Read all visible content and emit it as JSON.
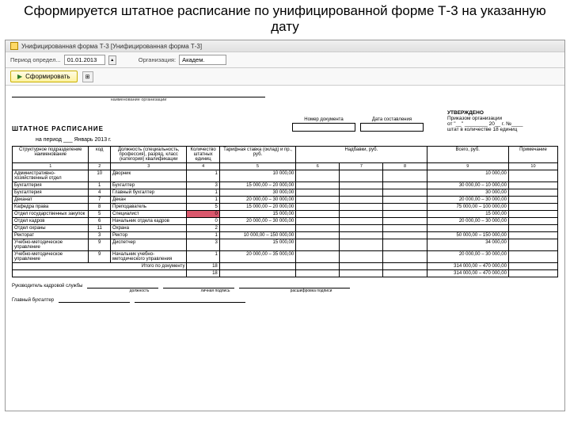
{
  "slide_title": "Сформируется штатное расписание по унифицированной форме Т-3 на указанную дату",
  "window": {
    "title": "Унифицированная форма Т-3 [Унифицированная форма Т-3]"
  },
  "toolbar": {
    "period_label": "Период определ...",
    "date": "01.01.2013",
    "org_label": "Организация:",
    "org_value": "Академ.",
    "generate": "Сформировать"
  },
  "doc": {
    "code_label": "",
    "org_sublabel": "наименование организации",
    "docnum_label": "Номер документа",
    "date_label": "Дата составления",
    "title": "ШТАТНОЕ РАСПИСАНИЕ",
    "approve_title": "УТВЕРЖДЕНО",
    "approve_line1": "Приказом организации",
    "approve_line2": "от \"__\" ________ 20__ г. №____",
    "approve_line3": "штат в количестве 18 единиц",
    "period": "на период ___ Январь 2013 г.",
    "cols": {
      "c1": "Структурное подразделение\nнаименование",
      "c2": "код",
      "c3": "Должность (специальность, профессия), разряд, класс (категория) квалификации",
      "c4": "Количество штатных единиц",
      "c5": "Тарифная ставка (оклад) и пр., руб.",
      "c6_8": "Надбавки, руб.",
      "c9": "Всего, руб.",
      "c10": "Примечание"
    },
    "rows": [
      {
        "dep": "Административно-хозяйственный отдел",
        "code": "10",
        "pos": "Дворник",
        "units": "1",
        "rate": "10 000,00",
        "a1": "",
        "a2": "",
        "a3": "",
        "total": "10 000,00"
      },
      {
        "dep": "Бухгалтерия",
        "code": "1",
        "pos": "Бухгалтер",
        "units": "3",
        "rate": "15 000,00 – 20 000,00",
        "a1": "",
        "a2": "",
        "a3": "",
        "total": "30 000,00 – 10 000,00"
      },
      {
        "dep": "Бухгалтерия",
        "code": "4",
        "pos": "Главный бухгалтер",
        "units": "1",
        "rate": "30 000,00",
        "a1": "",
        "a2": "",
        "a3": "",
        "total": "30 000,00"
      },
      {
        "dep": "Деканат",
        "code": "7",
        "pos": "Декан",
        "units": "1",
        "rate": "20 000,00 – 30 000,00",
        "a1": "",
        "a2": "",
        "a3": "",
        "total": "20 000,00 – 30 000,00"
      },
      {
        "dep": "Кафедра права",
        "code": "8",
        "pos": "Преподаватель",
        "units": "5",
        "rate": "15 000,00 – 20 000,00",
        "a1": "",
        "a2": "",
        "a3": "",
        "total": "75 000,00 – 100 000,00"
      },
      {
        "dep": "Отдел государственных закупок",
        "code": "5",
        "pos": "Специалист",
        "units": "0",
        "rate": "15 000,00",
        "a1": "",
        "a2": "",
        "a3": "",
        "total": "15 000,00",
        "hl": true
      },
      {
        "dep": "Отдел кадров",
        "code": "6",
        "pos": "Начальник отдела кадров",
        "units": "0",
        "rate": "20 000,00 – 30 000,00",
        "a1": "",
        "a2": "",
        "a3": "",
        "total": "20 000,00 – 30 000,00"
      },
      {
        "dep": "Отдел охраны",
        "code": "11",
        "pos": "Охрана",
        "units": "2",
        "rate": "",
        "a1": "",
        "a2": "",
        "a3": "",
        "total": ""
      },
      {
        "dep": "Ректорат",
        "code": "3",
        "pos": "Ректор",
        "units": "1",
        "rate": "10 000,00 – 150 000,00",
        "a1": "",
        "a2": "",
        "a3": "",
        "total": "50 000,00 – 150 000,00"
      },
      {
        "dep": "Учебно-методическое управление",
        "code": "9",
        "pos": "Диспетчер",
        "units": "3",
        "rate": "15 000,00",
        "a1": "",
        "a2": "",
        "a3": "",
        "total": "34 000,00"
      },
      {
        "dep": "Учебно-методическое управление",
        "code": "9",
        "pos": "Начальник учебно-методического управления",
        "units": "1",
        "rate": "20 000,00 – 35 000,00",
        "a1": "",
        "a2": "",
        "a3": "",
        "total": "20 000,00 – 30 000,00"
      }
    ],
    "total_label": "Итого по документу",
    "total_units": "18",
    "total_sum1": "314 000,00 – 470 000,00",
    "total_units2": "18",
    "total_sum2": "314 000,00 – 470 000,00",
    "sig1": "Руководитель кадровой службы",
    "sig2": "Главный бухгалтер",
    "sig_pos": "должность",
    "sig_sign": "личная подпись",
    "sig_name": "расшифровка подписи"
  }
}
